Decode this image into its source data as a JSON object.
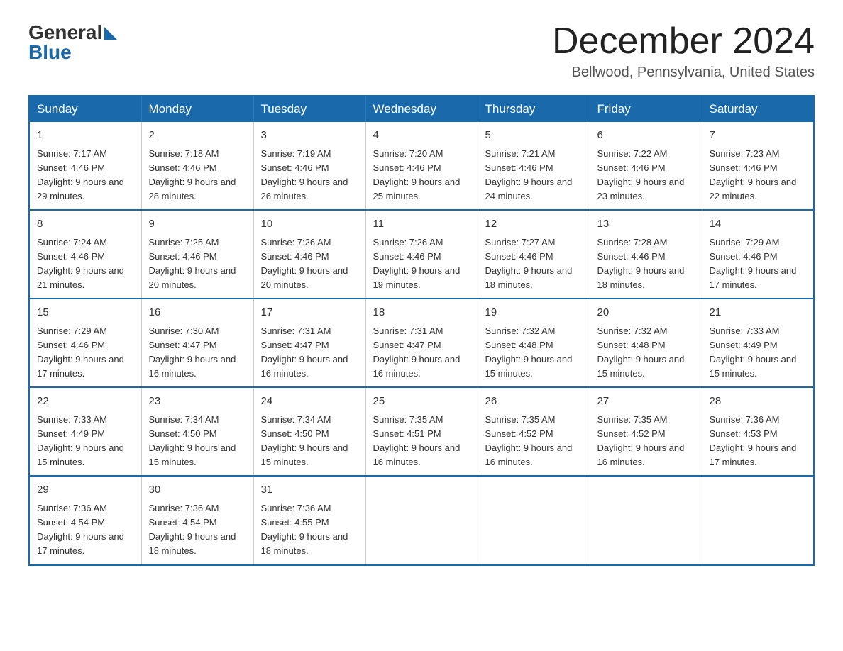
{
  "logo": {
    "text_general": "General",
    "text_blue": "Blue"
  },
  "header": {
    "month_year": "December 2024",
    "location": "Bellwood, Pennsylvania, United States"
  },
  "days_of_week": [
    "Sunday",
    "Monday",
    "Tuesday",
    "Wednesday",
    "Thursday",
    "Friday",
    "Saturday"
  ],
  "weeks": [
    [
      {
        "day": "1",
        "sunrise": "Sunrise: 7:17 AM",
        "sunset": "Sunset: 4:46 PM",
        "daylight": "Daylight: 9 hours and 29 minutes."
      },
      {
        "day": "2",
        "sunrise": "Sunrise: 7:18 AM",
        "sunset": "Sunset: 4:46 PM",
        "daylight": "Daylight: 9 hours and 28 minutes."
      },
      {
        "day": "3",
        "sunrise": "Sunrise: 7:19 AM",
        "sunset": "Sunset: 4:46 PM",
        "daylight": "Daylight: 9 hours and 26 minutes."
      },
      {
        "day": "4",
        "sunrise": "Sunrise: 7:20 AM",
        "sunset": "Sunset: 4:46 PM",
        "daylight": "Daylight: 9 hours and 25 minutes."
      },
      {
        "day": "5",
        "sunrise": "Sunrise: 7:21 AM",
        "sunset": "Sunset: 4:46 PM",
        "daylight": "Daylight: 9 hours and 24 minutes."
      },
      {
        "day": "6",
        "sunrise": "Sunrise: 7:22 AM",
        "sunset": "Sunset: 4:46 PM",
        "daylight": "Daylight: 9 hours and 23 minutes."
      },
      {
        "day": "7",
        "sunrise": "Sunrise: 7:23 AM",
        "sunset": "Sunset: 4:46 PM",
        "daylight": "Daylight: 9 hours and 22 minutes."
      }
    ],
    [
      {
        "day": "8",
        "sunrise": "Sunrise: 7:24 AM",
        "sunset": "Sunset: 4:46 PM",
        "daylight": "Daylight: 9 hours and 21 minutes."
      },
      {
        "day": "9",
        "sunrise": "Sunrise: 7:25 AM",
        "sunset": "Sunset: 4:46 PM",
        "daylight": "Daylight: 9 hours and 20 minutes."
      },
      {
        "day": "10",
        "sunrise": "Sunrise: 7:26 AM",
        "sunset": "Sunset: 4:46 PM",
        "daylight": "Daylight: 9 hours and 20 minutes."
      },
      {
        "day": "11",
        "sunrise": "Sunrise: 7:26 AM",
        "sunset": "Sunset: 4:46 PM",
        "daylight": "Daylight: 9 hours and 19 minutes."
      },
      {
        "day": "12",
        "sunrise": "Sunrise: 7:27 AM",
        "sunset": "Sunset: 4:46 PM",
        "daylight": "Daylight: 9 hours and 18 minutes."
      },
      {
        "day": "13",
        "sunrise": "Sunrise: 7:28 AM",
        "sunset": "Sunset: 4:46 PM",
        "daylight": "Daylight: 9 hours and 18 minutes."
      },
      {
        "day": "14",
        "sunrise": "Sunrise: 7:29 AM",
        "sunset": "Sunset: 4:46 PM",
        "daylight": "Daylight: 9 hours and 17 minutes."
      }
    ],
    [
      {
        "day": "15",
        "sunrise": "Sunrise: 7:29 AM",
        "sunset": "Sunset: 4:46 PM",
        "daylight": "Daylight: 9 hours and 17 minutes."
      },
      {
        "day": "16",
        "sunrise": "Sunrise: 7:30 AM",
        "sunset": "Sunset: 4:47 PM",
        "daylight": "Daylight: 9 hours and 16 minutes."
      },
      {
        "day": "17",
        "sunrise": "Sunrise: 7:31 AM",
        "sunset": "Sunset: 4:47 PM",
        "daylight": "Daylight: 9 hours and 16 minutes."
      },
      {
        "day": "18",
        "sunrise": "Sunrise: 7:31 AM",
        "sunset": "Sunset: 4:47 PM",
        "daylight": "Daylight: 9 hours and 16 minutes."
      },
      {
        "day": "19",
        "sunrise": "Sunrise: 7:32 AM",
        "sunset": "Sunset: 4:48 PM",
        "daylight": "Daylight: 9 hours and 15 minutes."
      },
      {
        "day": "20",
        "sunrise": "Sunrise: 7:32 AM",
        "sunset": "Sunset: 4:48 PM",
        "daylight": "Daylight: 9 hours and 15 minutes."
      },
      {
        "day": "21",
        "sunrise": "Sunrise: 7:33 AM",
        "sunset": "Sunset: 4:49 PM",
        "daylight": "Daylight: 9 hours and 15 minutes."
      }
    ],
    [
      {
        "day": "22",
        "sunrise": "Sunrise: 7:33 AM",
        "sunset": "Sunset: 4:49 PM",
        "daylight": "Daylight: 9 hours and 15 minutes."
      },
      {
        "day": "23",
        "sunrise": "Sunrise: 7:34 AM",
        "sunset": "Sunset: 4:50 PM",
        "daylight": "Daylight: 9 hours and 15 minutes."
      },
      {
        "day": "24",
        "sunrise": "Sunrise: 7:34 AM",
        "sunset": "Sunset: 4:50 PM",
        "daylight": "Daylight: 9 hours and 15 minutes."
      },
      {
        "day": "25",
        "sunrise": "Sunrise: 7:35 AM",
        "sunset": "Sunset: 4:51 PM",
        "daylight": "Daylight: 9 hours and 16 minutes."
      },
      {
        "day": "26",
        "sunrise": "Sunrise: 7:35 AM",
        "sunset": "Sunset: 4:52 PM",
        "daylight": "Daylight: 9 hours and 16 minutes."
      },
      {
        "day": "27",
        "sunrise": "Sunrise: 7:35 AM",
        "sunset": "Sunset: 4:52 PM",
        "daylight": "Daylight: 9 hours and 16 minutes."
      },
      {
        "day": "28",
        "sunrise": "Sunrise: 7:36 AM",
        "sunset": "Sunset: 4:53 PM",
        "daylight": "Daylight: 9 hours and 17 minutes."
      }
    ],
    [
      {
        "day": "29",
        "sunrise": "Sunrise: 7:36 AM",
        "sunset": "Sunset: 4:54 PM",
        "daylight": "Daylight: 9 hours and 17 minutes."
      },
      {
        "day": "30",
        "sunrise": "Sunrise: 7:36 AM",
        "sunset": "Sunset: 4:54 PM",
        "daylight": "Daylight: 9 hours and 18 minutes."
      },
      {
        "day": "31",
        "sunrise": "Sunrise: 7:36 AM",
        "sunset": "Sunset: 4:55 PM",
        "daylight": "Daylight: 9 hours and 18 minutes."
      },
      null,
      null,
      null,
      null
    ]
  ]
}
